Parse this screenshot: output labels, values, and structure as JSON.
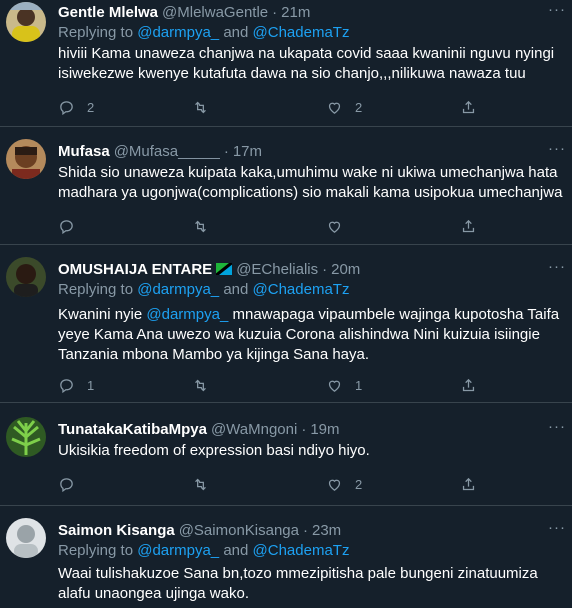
{
  "tweets": [
    {
      "name": "Gentle Mlelwa",
      "handle": "@MlelwaGentle",
      "dot": "·",
      "time": "21m",
      "reply_prefix": "Replying to",
      "reply_to_1": "@darmpya_",
      "reply_and": "and",
      "reply_to_2": "@ChademaTz",
      "text": "hiviii Kama unaweza chanjwa na ukapata covid saaa kwaninii nguvu nyingi isiwekezwe kwenye kutafuta dawa na sio chanjo,,,nilikuwa nawaza tuu",
      "reply_count": "2",
      "retweet_count": "",
      "like_count": "2"
    },
    {
      "name": "Mufasa",
      "handle": "@Mufasa_____",
      "dot": "·",
      "time": "17m",
      "text": "Shida sio unaweza kuipata kaka,umuhimu wake ni ukiwa umechanjwa hata madhara ya ugonjwa(complications) sio makali kama usipokua umechanjwa",
      "reply_count": "",
      "retweet_count": "",
      "like_count": ""
    },
    {
      "name": "OMUSHAIJA ENTARE",
      "handle": "@EChelialis",
      "dot": "·",
      "time": "20m",
      "reply_prefix": "Replying to",
      "reply_to_1": "@darmpya_",
      "reply_and": "and",
      "reply_to_2": "@ChademaTz",
      "text_before": "Kwanini nyie",
      "text_mention": "@darmpya_",
      "text_after": "mnawapaga vipaumbele wajinga kupotosha Taifa yeye Kama Ana uwezo wa kuzuia Corona alishindwa Nini kuizuia isiingie Tanzania mbona Mambo ya kijinga Sana haya.",
      "reply_count": "1",
      "retweet_count": "",
      "like_count": "1"
    },
    {
      "name": "TunatakaKatibaMpya",
      "handle": "@WaMngoni",
      "dot": "·",
      "time": "19m",
      "text": "Ukisikia freedom of expression basi ndiyo hiyo.",
      "reply_count": "",
      "retweet_count": "",
      "like_count": "2"
    },
    {
      "name": "Saimon Kisanga",
      "handle": "@SaimonKisanga",
      "dot": "·",
      "time": "23m",
      "reply_prefix": "Replying to",
      "reply_to_1": "@darmpya_",
      "reply_and": "and",
      "reply_to_2": "@ChademaTz",
      "text": "Waai tulishakuzoe Sana bn,tozo mmezipitisha pale bungeni zinatuumiza alafu unaongea ujinga wako."
    }
  ],
  "colors": {
    "background": "#15202b",
    "divider": "#38444d",
    "secondary_text": "#8899a6",
    "link": "#1da1f2",
    "primary_text": "#ffffff"
  },
  "icons": [
    "reply-icon",
    "retweet-icon",
    "like-icon",
    "share-icon",
    "more-icon",
    "tanzania-flag-icon"
  ]
}
